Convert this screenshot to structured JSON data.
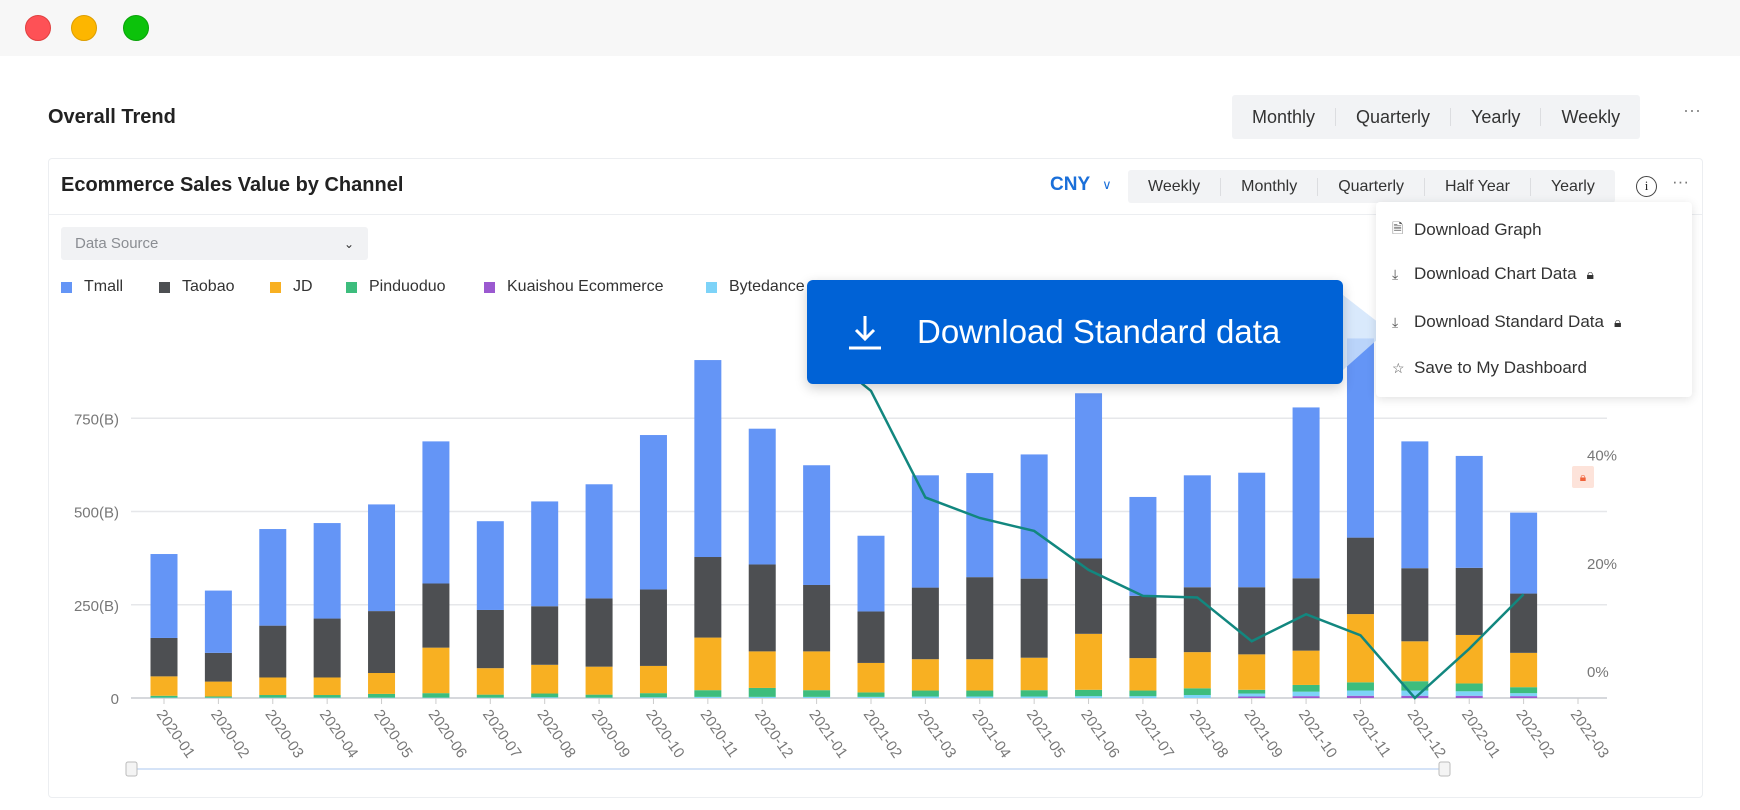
{
  "window": {
    "controls": [
      "close",
      "minimize",
      "maximize"
    ]
  },
  "header": {
    "title": "Overall Trend",
    "periods": [
      "Monthly",
      "Quarterly",
      "Yearly",
      "Weekly"
    ],
    "more": "···"
  },
  "card": {
    "title": "Ecommerce Sales Value by Channel",
    "currency": "CNY",
    "periods": [
      "Weekly",
      "Monthly",
      "Quarterly",
      "Half Year",
      "Yearly"
    ],
    "more": "···",
    "data_source_placeholder": "Data Source"
  },
  "menu": {
    "items": [
      {
        "label": "Download Graph",
        "icon": "file-image-icon",
        "locked": false
      },
      {
        "label": "Download Chart Data",
        "icon": "download-icon",
        "locked": true
      },
      {
        "label": "Download Standard Data",
        "icon": "download-icon",
        "locked": true
      },
      {
        "label": "Save to My Dashboard",
        "icon": "star-icon",
        "locked": false
      }
    ]
  },
  "tooltip": {
    "label": "Download Standard data",
    "icon": "download-icon",
    "color": "#0062d6"
  },
  "chart_data": {
    "type": "bar",
    "stacked": true,
    "categories": [
      "2020-01",
      "2020-02",
      "2020-03",
      "2020-04",
      "2020-05",
      "2020-06",
      "2020-07",
      "2020-08",
      "2020-09",
      "2020-10",
      "2020-11",
      "2020-12",
      "2021-01",
      "2021-02",
      "2021-03",
      "2021-04",
      "2021-05",
      "2021-06",
      "2021-07",
      "2021-08",
      "2021-09",
      "2021-10",
      "2021-11",
      "2021-12",
      "2022-01",
      "2022-02",
      "2022-03"
    ],
    "y_unit": "B",
    "ylim": [
      0,
      1000
    ],
    "y_ticks": [
      "0",
      "250(B)",
      "500(B)",
      "750(B)"
    ],
    "y2_ticks": [
      "0%",
      "20%",
      "40%"
    ],
    "y2lim": [
      -5,
      64
    ],
    "grid": true,
    "legend_position": "top-left",
    "series": [
      {
        "name": "Kuaishou Ecommerce",
        "color": "#9b59d0",
        "values": [
          0,
          0,
          0,
          0,
          0,
          0,
          0,
          0,
          0,
          0,
          0,
          0,
          0,
          0,
          0,
          0,
          0,
          0,
          0,
          0,
          4,
          5,
          6,
          6,
          6,
          5,
          null
        ]
      },
      {
        "name": "Bytedance",
        "color": "#7dd3f8",
        "values": [
          1,
          1,
          1,
          1,
          1,
          1,
          1,
          2,
          1,
          2,
          3,
          3,
          3,
          3,
          4,
          4,
          4,
          5,
          5,
          8,
          8,
          12,
          14,
          14,
          12,
          8,
          null
        ]
      },
      {
        "name": "Pinduoduo",
        "color": "#3dbd7d",
        "values": [
          5,
          3,
          7,
          7,
          10,
          12,
          8,
          10,
          8,
          11,
          18,
          24,
          18,
          12,
          16,
          16,
          17,
          17,
          15,
          18,
          10,
          18,
          22,
          25,
          21,
          16,
          null
        ]
      },
      {
        "name": "JD",
        "color": "#f8b022",
        "values": [
          52,
          40,
          47,
          47,
          56,
          122,
          71,
          77,
          75,
          73,
          141,
          98,
          104,
          79,
          84,
          84,
          87,
          150,
          87,
          97,
          95,
          92,
          183,
          107,
          130,
          92,
          null
        ]
      },
      {
        "name": "Taobao",
        "color": "#4d4f52",
        "values": [
          103,
          77,
          139,
          158,
          166,
          172,
          156,
          157,
          183,
          205,
          216,
          233,
          178,
          138,
          192,
          220,
          212,
          202,
          167,
          174,
          180,
          194,
          205,
          196,
          180,
          159,
          null
        ]
      },
      {
        "name": "Tmall",
        "color": "#6495f6",
        "values": [
          225,
          167,
          259,
          256,
          286,
          381,
          238,
          281,
          306,
          414,
          528,
          364,
          321,
          203,
          301,
          279,
          333,
          443,
          265,
          300,
          307,
          458,
          534,
          340,
          300,
          217,
          null
        ]
      }
    ],
    "line_series": {
      "axis": "right",
      "color": "#12877f",
      "values": [
        null,
        null,
        null,
        null,
        null,
        null,
        null,
        null,
        null,
        null,
        null,
        null,
        60,
        51.8,
        32.1,
        28.3,
        25.9,
        18.7,
        13.9,
        13.6,
        5.5,
        10.5,
        6.6,
        -5.0,
        4.1,
        14.2,
        null
      ]
    }
  }
}
